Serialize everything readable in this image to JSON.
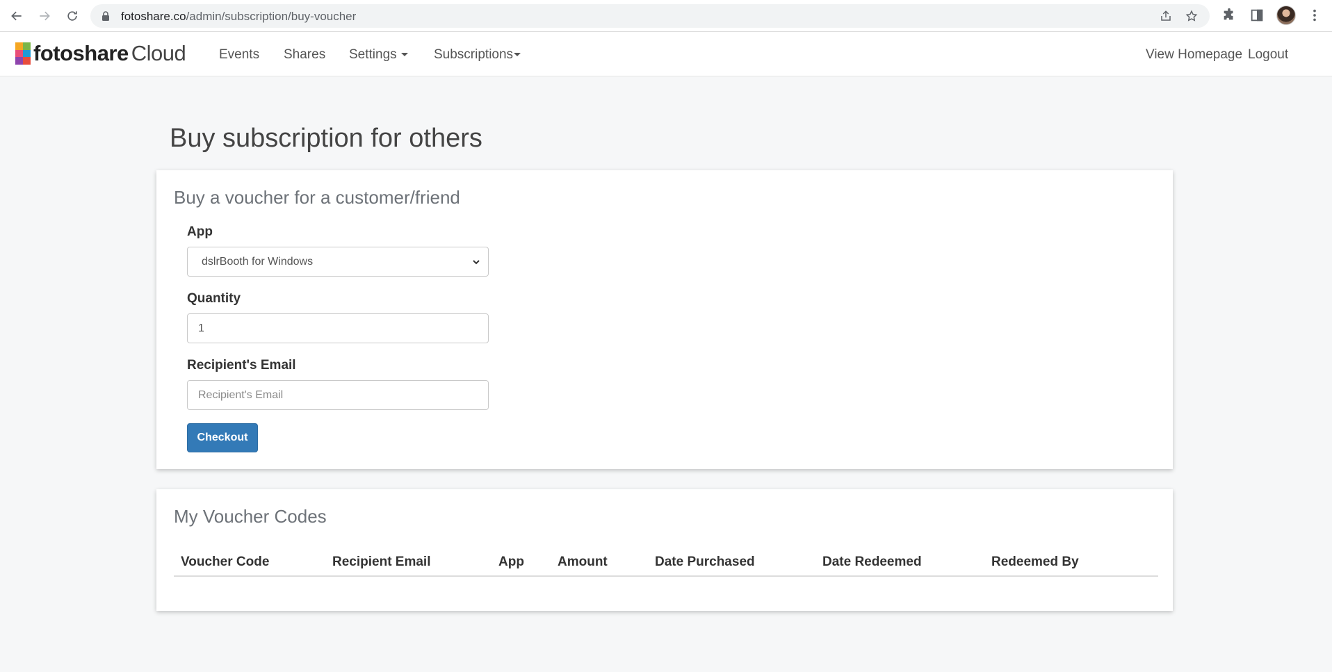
{
  "browser": {
    "url_host": "fotoshare.co",
    "url_path": "/admin/subscription/buy-voucher"
  },
  "nav": {
    "logo_brand": "fotoshare",
    "logo_suffix": "Cloud",
    "items": [
      {
        "label": "Events"
      },
      {
        "label": "Shares"
      },
      {
        "label": "Settings"
      },
      {
        "label": "Subscriptions"
      }
    ],
    "right": [
      {
        "label": "View Homepage"
      },
      {
        "label": "Logout"
      }
    ]
  },
  "page": {
    "title": "Buy subscription for others"
  },
  "voucher_form": {
    "title": "Buy a voucher for a customer/friend",
    "app_label": "App",
    "app_selected": "dslrBooth for Windows",
    "quantity_label": "Quantity",
    "quantity_value": "1",
    "email_label": "Recipient's Email",
    "email_placeholder": "Recipient's Email",
    "checkout_label": "Checkout"
  },
  "voucher_codes": {
    "title": "My Voucher Codes",
    "columns": [
      "Voucher Code",
      "Recipient Email",
      "App",
      "Amount",
      "Date Purchased",
      "Date Redeemed",
      "Redeemed By"
    ]
  },
  "colors": {
    "primary_button": "#337ab7",
    "page_background": "#f6f7f8"
  }
}
